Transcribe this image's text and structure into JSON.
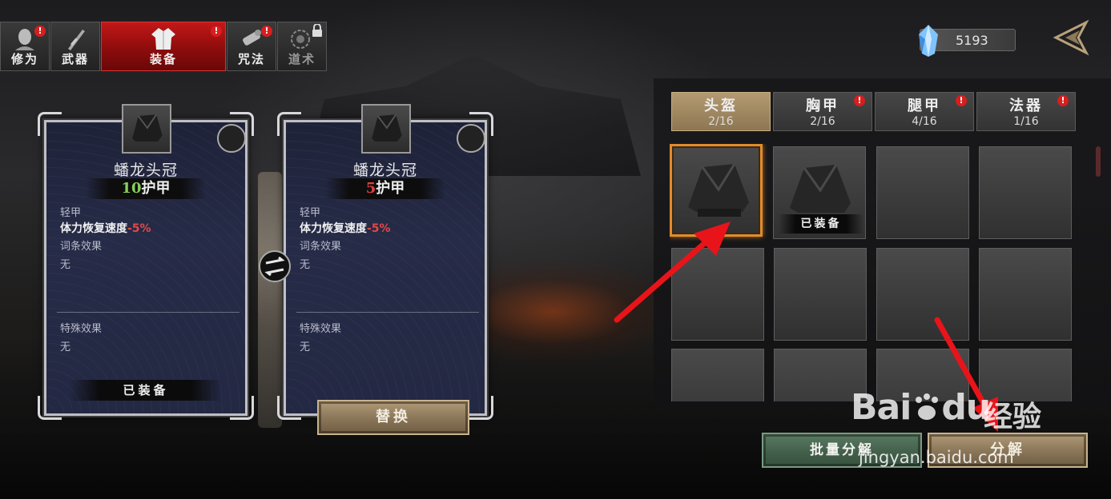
{
  "top_tabs": [
    {
      "label": "修为",
      "badge": "!",
      "icon": "face-icon",
      "active": false,
      "locked": false
    },
    {
      "label": "武器",
      "badge": "",
      "icon": "weapon-icon",
      "active": false,
      "locked": false
    },
    {
      "label": "装备",
      "badge": "!",
      "icon": "robe-icon",
      "active": true,
      "locked": false
    },
    {
      "label": "咒法",
      "badge": "!",
      "icon": "scroll-icon",
      "active": false,
      "locked": false
    },
    {
      "label": "道术",
      "badge": "",
      "icon": "bagua-icon",
      "active": false,
      "locked": true
    }
  ],
  "currency": {
    "amount": "5193",
    "icon": "crystal-icon"
  },
  "cards": [
    {
      "name": "蟠龙头冠",
      "armor_value": "10",
      "armor_suffix": "护甲",
      "armor_color": "#86d15a",
      "weight": "轻甲",
      "stat_label": "体力恢复速度",
      "stat_value": "-5%",
      "affix_label": "词条效果",
      "affix_value": "无",
      "special_label": "特殊效果",
      "special_value": "无",
      "footer": "已装备"
    },
    {
      "name": "蟠龙头冠",
      "armor_value": "5",
      "armor_suffix": "护甲",
      "armor_color": "#e14040",
      "weight": "轻甲",
      "stat_label": "体力恢复速度",
      "stat_value": "-5%",
      "affix_label": "词条效果",
      "affix_value": "无",
      "special_label": "特殊效果",
      "special_value": "无"
    }
  ],
  "replace_button": "替换",
  "categories": [
    {
      "name": "头盔",
      "count": "2/16",
      "badge": "",
      "active": true
    },
    {
      "name": "胸甲",
      "count": "2/16",
      "badge": "!",
      "active": false
    },
    {
      "name": "腿甲",
      "count": "4/16",
      "badge": "!",
      "active": false
    },
    {
      "name": "法器",
      "count": "1/16",
      "badge": "!",
      "active": false
    }
  ],
  "inventory_slots": [
    {
      "item": "helmet",
      "selected": true,
      "equipped": false
    },
    {
      "item": "helmet",
      "selected": false,
      "equipped": true,
      "tag": "已装备"
    },
    {
      "item": "",
      "selected": false,
      "equipped": false
    },
    {
      "item": "",
      "selected": false,
      "equipped": false
    },
    {
      "item": "",
      "selected": false,
      "equipped": false
    },
    {
      "item": "",
      "selected": false,
      "equipped": false
    },
    {
      "item": "",
      "selected": false,
      "equipped": false
    },
    {
      "item": "",
      "selected": false,
      "equipped": false
    },
    {
      "item": "",
      "selected": false,
      "equipped": false
    },
    {
      "item": "",
      "selected": false,
      "equipped": false
    },
    {
      "item": "",
      "selected": false,
      "equipped": false
    },
    {
      "item": "",
      "selected": false,
      "equipped": false
    }
  ],
  "batch_decompose_button": "批量分解",
  "decompose_button": "分解",
  "watermark": {
    "brand": "Bai",
    "brand2": "du",
    "jingyan": "经验",
    "url": "jingyan.baidu.com"
  },
  "annotation_color": "#e8141a"
}
